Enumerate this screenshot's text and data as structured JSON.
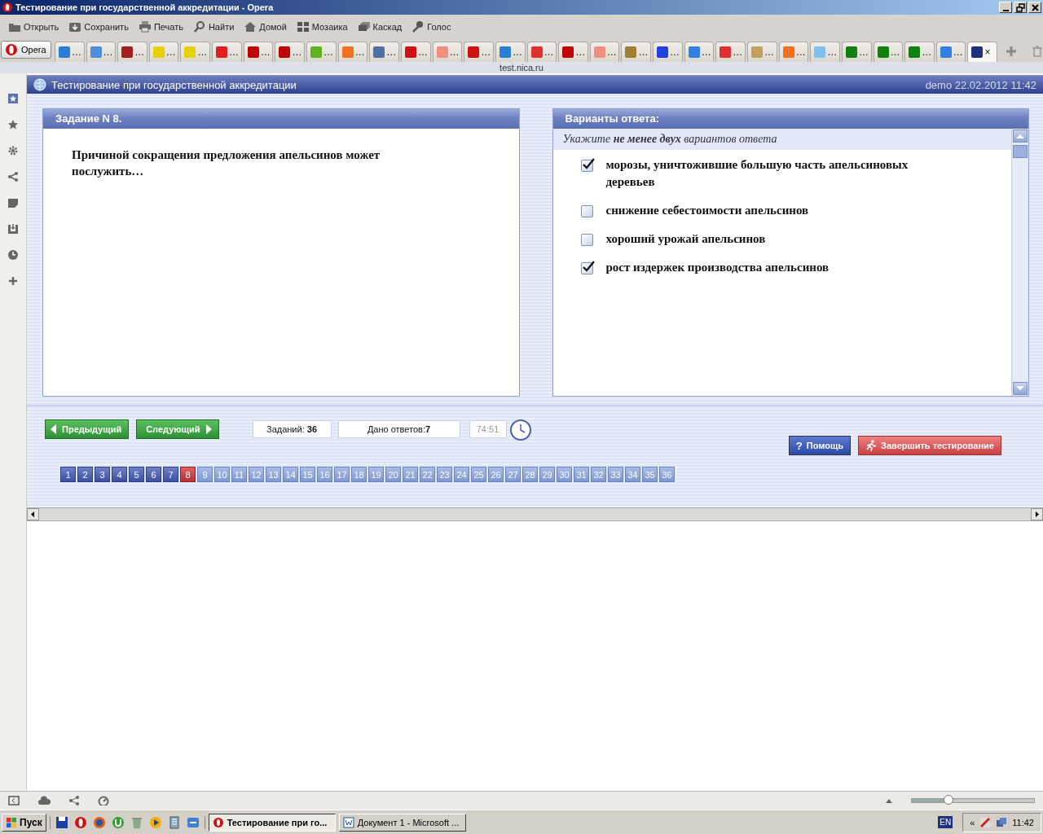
{
  "window": {
    "title": "Тестирование при государственной аккредитации - Opera"
  },
  "toolbar": [
    {
      "label": "Открыть",
      "kind": "folder"
    },
    {
      "label": "Сохранить",
      "kind": "save"
    },
    {
      "label": "Печать",
      "kind": "print"
    },
    {
      "label": "Найти",
      "kind": "search"
    },
    {
      "label": "Домой",
      "kind": "home"
    },
    {
      "label": "Мозаика",
      "kind": "tile"
    },
    {
      "label": "Каскад",
      "kind": "cascade"
    },
    {
      "label": "Голос",
      "kind": "voice"
    }
  ],
  "browser_tabs": {
    "menu_button": "Opera",
    "tabs": [
      {
        "label": "…",
        "color": "#2a7fd4",
        "selected": false
      },
      {
        "label": "…",
        "color": "#4a90d9",
        "selected": false
      },
      {
        "label": "…",
        "color": "#a02020",
        "selected": false
      },
      {
        "label": "…",
        "color": "#e8d000",
        "selected": false
      },
      {
        "label": "…",
        "color": "#e8d000",
        "selected": false
      },
      {
        "label": "…",
        "color": "#e02020",
        "selected": false
      },
      {
        "label": "…",
        "color": "#c00000",
        "selected": false
      },
      {
        "label": "…",
        "color": "#c00000",
        "selected": false
      },
      {
        "label": "…",
        "color": "#60b020",
        "selected": false
      },
      {
        "label": "…",
        "color": "#f07020",
        "selected": false
      },
      {
        "label": "…",
        "color": "#5070a0",
        "selected": false
      },
      {
        "label": "…",
        "color": "#d01010",
        "selected": false
      },
      {
        "label": "…",
        "color": "#f09080",
        "selected": false
      },
      {
        "label": "…",
        "color": "#d01010",
        "selected": false
      },
      {
        "label": "…",
        "color": "#2a7fd4",
        "selected": false
      },
      {
        "label": "…",
        "color": "#e03030",
        "selected": false
      },
      {
        "label": "…",
        "color": "#c00000",
        "selected": false
      },
      {
        "label": "…",
        "color": "#f09080",
        "selected": false
      },
      {
        "label": "…",
        "color": "#a08030",
        "selected": false
      },
      {
        "label": "…",
        "color": "#2040e0",
        "selected": false
      },
      {
        "label": "…",
        "color": "#3080e0",
        "selected": false
      },
      {
        "label": "…",
        "color": "#e03030",
        "selected": false
      },
      {
        "label": "…",
        "color": "#c0a060",
        "selected": false
      },
      {
        "label": "…",
        "color": "#f07020",
        "selected": false
      },
      {
        "label": "…",
        "color": "#80c0f0",
        "selected": false
      },
      {
        "label": "…",
        "color": "#108010",
        "selected": false
      },
      {
        "label": "…",
        "color": "#108010",
        "selected": false
      },
      {
        "label": "…",
        "color": "#108010",
        "selected": false
      },
      {
        "label": "…",
        "color": "#3080e0",
        "selected": false
      },
      {
        "close": "×",
        "color": "#203080",
        "selected": true
      }
    ]
  },
  "address": "test.nica.ru",
  "app": {
    "title": "Тестирование при государственной аккредитации",
    "session": "demo 22.02.2012 11:42"
  },
  "task_panel": {
    "title": "Задание N 8.",
    "question": "Причиной сокращения предложения апельсинов может послужить…"
  },
  "answers_panel": {
    "title": "Варианты ответа:",
    "instruction": "Укажите **не менее двух** вариантов ответа",
    "options": [
      {
        "text": "морозы, уничтожившие большую часть апельсиновых деревьев",
        "checked": true
      },
      {
        "text": "снижение себестоимости апельсинов",
        "checked": false
      },
      {
        "text": "хороший урожай апельсинов",
        "checked": false
      },
      {
        "text": "рост издержек производства апельсинов",
        "checked": true
      }
    ]
  },
  "navigation": {
    "prev": "Предыдущий",
    "next": "Следующий",
    "tasks_count": "Заданий: **36**",
    "answered_count": "Дано ответов:**7**",
    "timer": "74:51",
    "help": "Помощь",
    "help_icon": "?",
    "finish": "Завершить тестирование",
    "questions": [
      {
        "label": "1",
        "answered": true,
        "selected": false
      },
      {
        "label": "2",
        "answered": true,
        "selected": false
      },
      {
        "label": "3",
        "answered": true,
        "selected": false
      },
      {
        "label": "4",
        "answered": true,
        "selected": false
      },
      {
        "label": "5",
        "answered": true,
        "selected": false
      },
      {
        "label": "6",
        "answered": true,
        "selected": false
      },
      {
        "label": "7",
        "answered": true,
        "selected": false
      },
      {
        "label": "8",
        "answered": false,
        "selected": true
      },
      {
        "label": "9",
        "answered": false,
        "selected": false
      },
      {
        "label": "10",
        "answered": false,
        "selected": false
      },
      {
        "label": "11",
        "answered": false,
        "selected": false
      },
      {
        "label": "12",
        "answered": false,
        "selected": false
      },
      {
        "label": "13",
        "answered": false,
        "selected": false
      },
      {
        "label": "14",
        "answered": false,
        "selected": false
      },
      {
        "label": "15",
        "answered": false,
        "selected": false
      },
      {
        "label": "16",
        "answered": false,
        "selected": false
      },
      {
        "label": "17",
        "answered": false,
        "selected": false
      },
      {
        "label": "18",
        "answered": false,
        "selected": false
      },
      {
        "label": "19",
        "answered": false,
        "selected": false
      },
      {
        "label": "20",
        "answered": false,
        "selected": false
      },
      {
        "label": "21",
        "answered": false,
        "selected": false
      },
      {
        "label": "22",
        "answered": false,
        "selected": false
      },
      {
        "label": "23",
        "answered": false,
        "selected": false
      },
      {
        "label": "24",
        "answered": false,
        "selected": false
      },
      {
        "label": "25",
        "answered": false,
        "selected": false
      },
      {
        "label": "26",
        "answered": false,
        "selected": false
      },
      {
        "label": "27",
        "answered": false,
        "selected": false
      },
      {
        "label": "28",
        "answered": false,
        "selected": false
      },
      {
        "label": "29",
        "answered": false,
        "selected": false
      },
      {
        "label": "30",
        "answered": false,
        "selected": false
      },
      {
        "label": "31",
        "answered": false,
        "selected": false
      },
      {
        "label": "32",
        "answered": false,
        "selected": false
      },
      {
        "label": "33",
        "answered": false,
        "selected": false
      },
      {
        "label": "34",
        "answered": false,
        "selected": false
      },
      {
        "label": "35",
        "answered": false,
        "selected": false
      },
      {
        "label": "36",
        "answered": false,
        "selected": false
      }
    ]
  },
  "status_bar": {
    "zoom": {
      "level": 0.3
    }
  },
  "taskbar": {
    "start": "Пуск",
    "tasks": [
      {
        "label": "Тестирование при го...",
        "kind": "opera",
        "selected": true
      },
      {
        "label": "Документ 1 - Microsoft ...",
        "kind": "word",
        "selected": false
      }
    ],
    "language": "EN",
    "tray_expand": "«",
    "clock": "11:42"
  }
}
